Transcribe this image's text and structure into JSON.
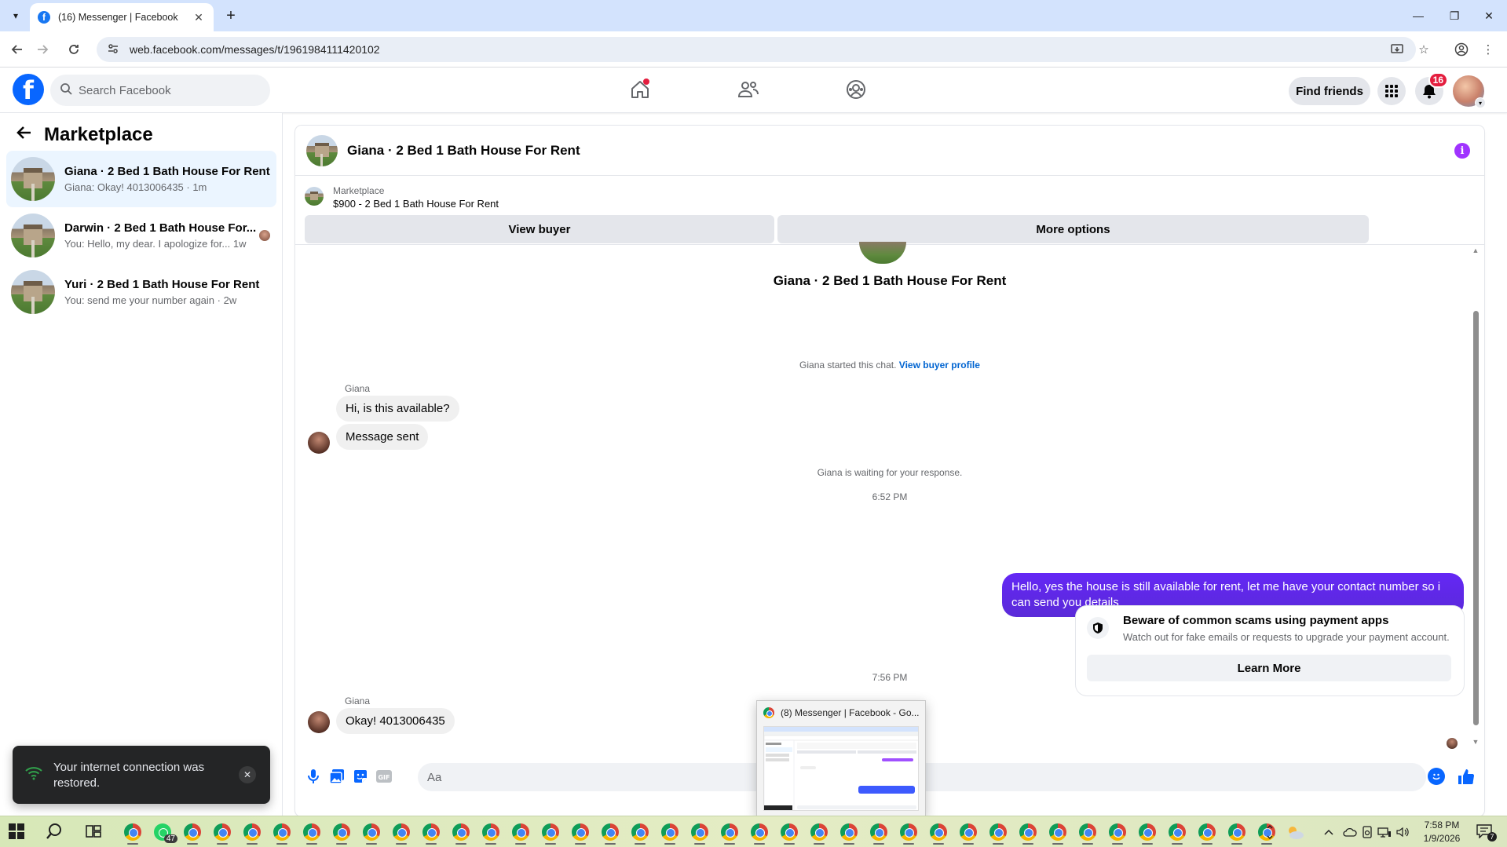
{
  "browser": {
    "tab_title": "(16) Messenger | Facebook",
    "tab_close": "✕",
    "new_tab": "+",
    "url": "web.facebook.com/messages/t/1961984111420102",
    "window_minimize": "—",
    "window_restore": "❐",
    "window_close": "✕"
  },
  "header": {
    "search_placeholder": "Search Facebook",
    "find_friends_label": "Find friends",
    "notifications_count": "16"
  },
  "sidebar": {
    "title": "Marketplace",
    "conversations": [
      {
        "name": "Giana · 2 Bed 1 Bath House For Rent",
        "snippet": "Giana: Okay! 4013006435 · 1m"
      },
      {
        "name": "Darwin · 2 Bed 1 Bath House For...",
        "snippet": "You: Hello, my dear. I apologize for...  1w"
      },
      {
        "name": "Yuri · 2 Bed 1 Bath House For Rent",
        "snippet": "You: send me your number again · 2w"
      }
    ]
  },
  "chat": {
    "title": "Giana · 2 Bed 1 Bath House For Rent",
    "marketplace_label": "Marketplace",
    "listing": "$900 - 2 Bed 1 Bath House For Rent",
    "view_buyer_label": "View buyer",
    "more_options_label": "More options",
    "hero_name": "Giana · 2 Bed 1 Bath House For Rent",
    "started_text": "Giana started this chat.",
    "view_buyer_profile": "View buyer profile",
    "sender_name": "Giana",
    "msg1": "Hi, is this available?",
    "msg2": "Message sent",
    "waiting_text": "Giana is waiting for your response.",
    "time1": "6:52 PM",
    "outgoing": "Hello, yes the house is still available for rent, let me have your contact number so i can send you  details",
    "scam_title": "Beware of common scams using payment apps",
    "scam_desc": "Watch out for fake emails or requests to upgrade your payment account.",
    "learn_more": "Learn More",
    "time2": "7:56 PM",
    "sender_name2": "Giana",
    "msg3": "Okay! 4013006435",
    "composer_placeholder": "Aa"
  },
  "toast": {
    "message": "Your internet connection was restored.",
    "close": "✕"
  },
  "preview": {
    "title": "(8) Messenger | Facebook - Go..."
  },
  "taskbar": {
    "whatsapp_count": "47",
    "time": "7:58 PM",
    "date": "1/9/2026",
    "notification_count": "7"
  },
  "colors": {
    "facebook_blue": "#0866ff",
    "messenger_purple": "#5a2ad8",
    "badge_red": "#e41e3f"
  }
}
